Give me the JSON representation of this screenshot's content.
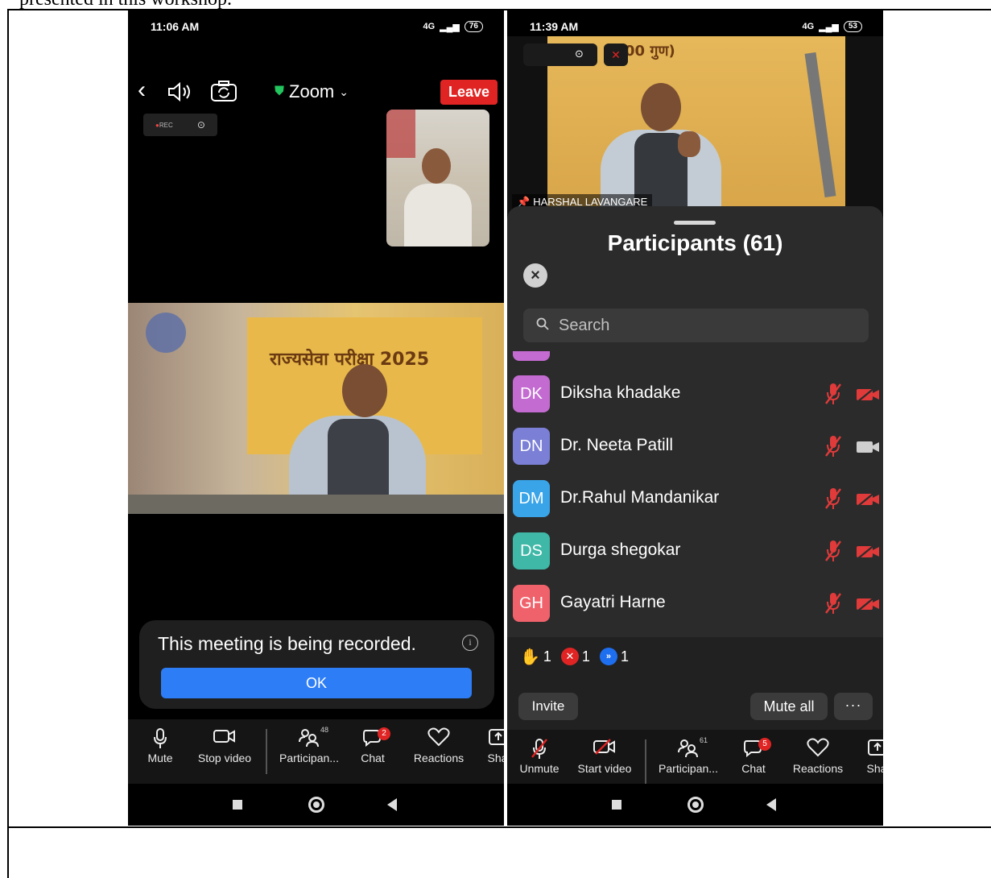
{
  "document": {
    "caption_fragment": "presented in this workshop."
  },
  "colors": {
    "accent_blue": "#2d7df6",
    "leave_red": "#e02424",
    "panel_bg": "#2b2b2b"
  },
  "phone1": {
    "status": {
      "time": "11:06 AM",
      "network": "4G",
      "battery": "76"
    },
    "header": {
      "app_title": "Zoom",
      "leave_label": "Leave"
    },
    "rec_indicator": "REC",
    "main_video": {
      "banner_text": "राज्यसेवा परीक्षा 2025"
    },
    "recording_notice": {
      "message": "This meeting is being recorded.",
      "ok_label": "OK"
    },
    "toolbar": {
      "mute": "Mute",
      "stop_video": "Stop video",
      "participants": "Participan...",
      "participants_count": "48",
      "chat": "Chat",
      "chat_badge": "2",
      "reactions": "Reactions",
      "share": "Sha"
    }
  },
  "phone2": {
    "status": {
      "time": "11:39 AM",
      "network": "4G",
      "battery": "53"
    },
    "video": {
      "board_title": "00 गुण)",
      "pinned_name": "HARSHAL LAVANGARE"
    },
    "panel": {
      "title": "Participants (61)",
      "search_placeholder": "Search",
      "participants": [
        {
          "initials": "DK",
          "name": "Diksha khadake",
          "color": "#c36bd1",
          "video": "off"
        },
        {
          "initials": "DN",
          "name": "Dr. Neeta Patill",
          "color": "#7b7fd6",
          "video": "on"
        },
        {
          "initials": "DM",
          "name": "Dr.Rahul Mandanikar",
          "color": "#3aa4e8",
          "video": "off"
        },
        {
          "initials": "DS",
          "name": "Durga shegokar",
          "color": "#3fb8a8",
          "video": "off"
        },
        {
          "initials": "GH",
          "name": "Gayatri Harne",
          "color": "#f0626b",
          "video": "off"
        }
      ],
      "counts": {
        "raised_hands": "1",
        "no": "1",
        "go_faster": "1"
      },
      "invite_label": "Invite",
      "mute_all_label": "Mute all",
      "more_label": "···"
    },
    "toolbar": {
      "unmute": "Unmute",
      "start_video": "Start video",
      "participants": "Participan...",
      "participants_count": "61",
      "chat": "Chat",
      "chat_badge": "5",
      "reactions": "Reactions",
      "share": "Sha"
    }
  }
}
